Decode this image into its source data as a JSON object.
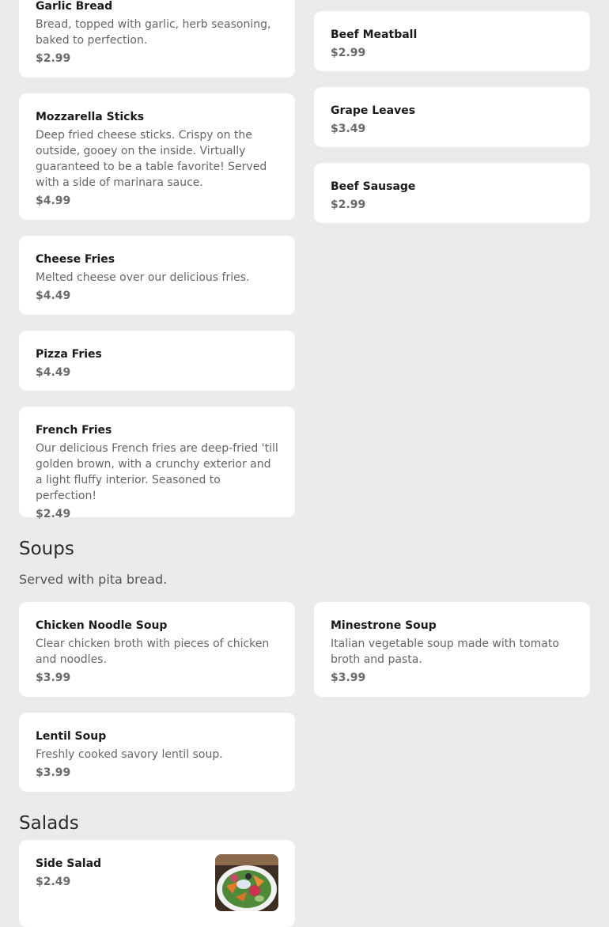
{
  "appetizers": [
    {
      "name": "Garlic Bread",
      "desc": "Bread, topped with garlic, herb seasoning, baked to perfection.",
      "price": "$2.99"
    },
    {
      "name": "Mozzarella Sticks",
      "desc": "Deep fried cheese sticks. Crispy on the outside, gooey on the inside. Virtually guaranteed to be a table favorite! Served with a side of marinara sauce.",
      "price": "$4.99"
    },
    {
      "name": "Cheese Fries",
      "desc": "Melted cheese over our delicious fries.",
      "price": "$4.49"
    },
    {
      "name": "Pizza Fries",
      "price": "$4.49"
    },
    {
      "name": "French Fries",
      "desc": "Our delicious French fries are deep-fried 'till golden brown, with a crunchy exterior and a light fluffy interior. Seasoned to perfection!",
      "price": "$2.49"
    },
    {
      "name": "Beef Meatball",
      "price": "$2.99"
    },
    {
      "name": "Grape Leaves",
      "price": "$3.49"
    },
    {
      "name": "Beef Sausage",
      "price": "$2.99"
    }
  ],
  "soups": {
    "title": "Soups",
    "subtitle": "Served with pita bread.",
    "items": [
      {
        "name": "Chicken Noodle Soup",
        "desc": "Clear chicken broth with pieces of chicken and noodles.",
        "price": "$3.99"
      },
      {
        "name": "Minestrone Soup",
        "desc": "Italian vegetable soup made with tomato broth and pasta.",
        "price": "$3.99"
      },
      {
        "name": "Lentil Soup",
        "desc": "Freshly cooked savory lentil soup.",
        "price": "$3.99"
      }
    ]
  },
  "salads": {
    "title": "Salads",
    "items": [
      {
        "name": "Side Salad",
        "price": "$2.49",
        "image": "salad-photo"
      }
    ]
  }
}
